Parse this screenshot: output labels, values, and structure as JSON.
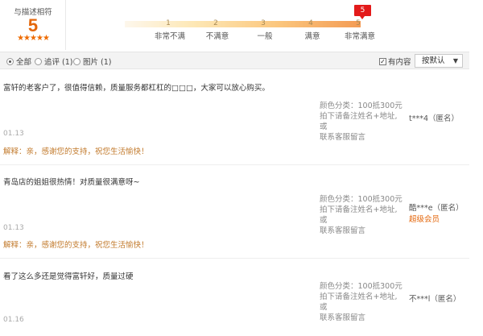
{
  "summary": {
    "label": "与描述相符",
    "score": "5",
    "stars": "★★★★★"
  },
  "rating_scale": {
    "selected": "5",
    "ticks": [
      {
        "num": "1",
        "text": "非常不满"
      },
      {
        "num": "2",
        "text": "不满意"
      },
      {
        "num": "3",
        "text": "一般"
      },
      {
        "num": "4",
        "text": "满意"
      },
      {
        "num": "5",
        "text": "非常满意"
      }
    ]
  },
  "filters": {
    "all": "全部",
    "append": "追评 (1)",
    "pictures": "图片 (1)",
    "has_content": "有内容",
    "has_content_checked": "✓",
    "sort": "按默认"
  },
  "reviews": [
    {
      "text": "富轩的老客户了，很值得信赖，质量服务都杠杠的□□□，大家可以放心购买。",
      "sku_line1": "颜色分类：100抵300元",
      "sku_line2": "拍下请备注姓名+地址,或",
      "sku_line3": "联系客服留言",
      "user": "t***4（匿名）",
      "badge": "",
      "date": "01.13",
      "reply": "解释：亲，感谢您的支持，祝您生活愉快！"
    },
    {
      "text": "青岛店的姐姐很热情！对质量很满意呀~",
      "sku_line1": "颜色分类：100抵300元",
      "sku_line2": "拍下请备注姓名+地址,或",
      "sku_line3": "联系客服留言",
      "user": "酷***e（匿名）",
      "badge": "超级会员",
      "date": "01.13",
      "reply": "解释：亲，感谢您的支持，祝您生活愉快！"
    },
    {
      "text": "看了这么多还是觉得富轩好，质量过硬",
      "sku_line1": "颜色分类：100抵300元",
      "sku_line2": "拍下请备注姓名+地址,或",
      "sku_line3": "联系客服留言",
      "user": "不***l（匿名）",
      "badge": "",
      "date": "01.16",
      "reply": ""
    }
  ]
}
